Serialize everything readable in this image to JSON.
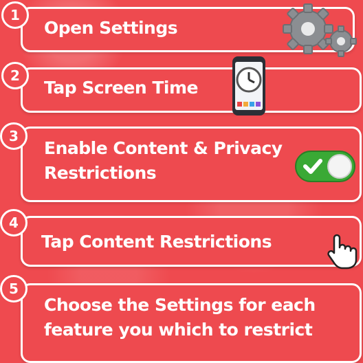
{
  "steps": [
    {
      "number": "1",
      "label": "Open Settings",
      "icon": "gears-icon"
    },
    {
      "number": "2",
      "label": "Tap Screen Time",
      "icon": "phone-clock-icon"
    },
    {
      "number": "3",
      "label": "Enable Content & Privacy\nRestrictions",
      "icon": "toggle-on-icon"
    },
    {
      "number": "4",
      "label": "Tap Content Restrictions",
      "icon": "pointer-hand-icon"
    },
    {
      "number": "5",
      "label": "Choose the Settings for each\nfeature you which to restrict",
      "icon": ""
    }
  ],
  "colors": {
    "background": "#ef4a4f",
    "accent": "#ffffff",
    "toggle": "#3aa935"
  }
}
